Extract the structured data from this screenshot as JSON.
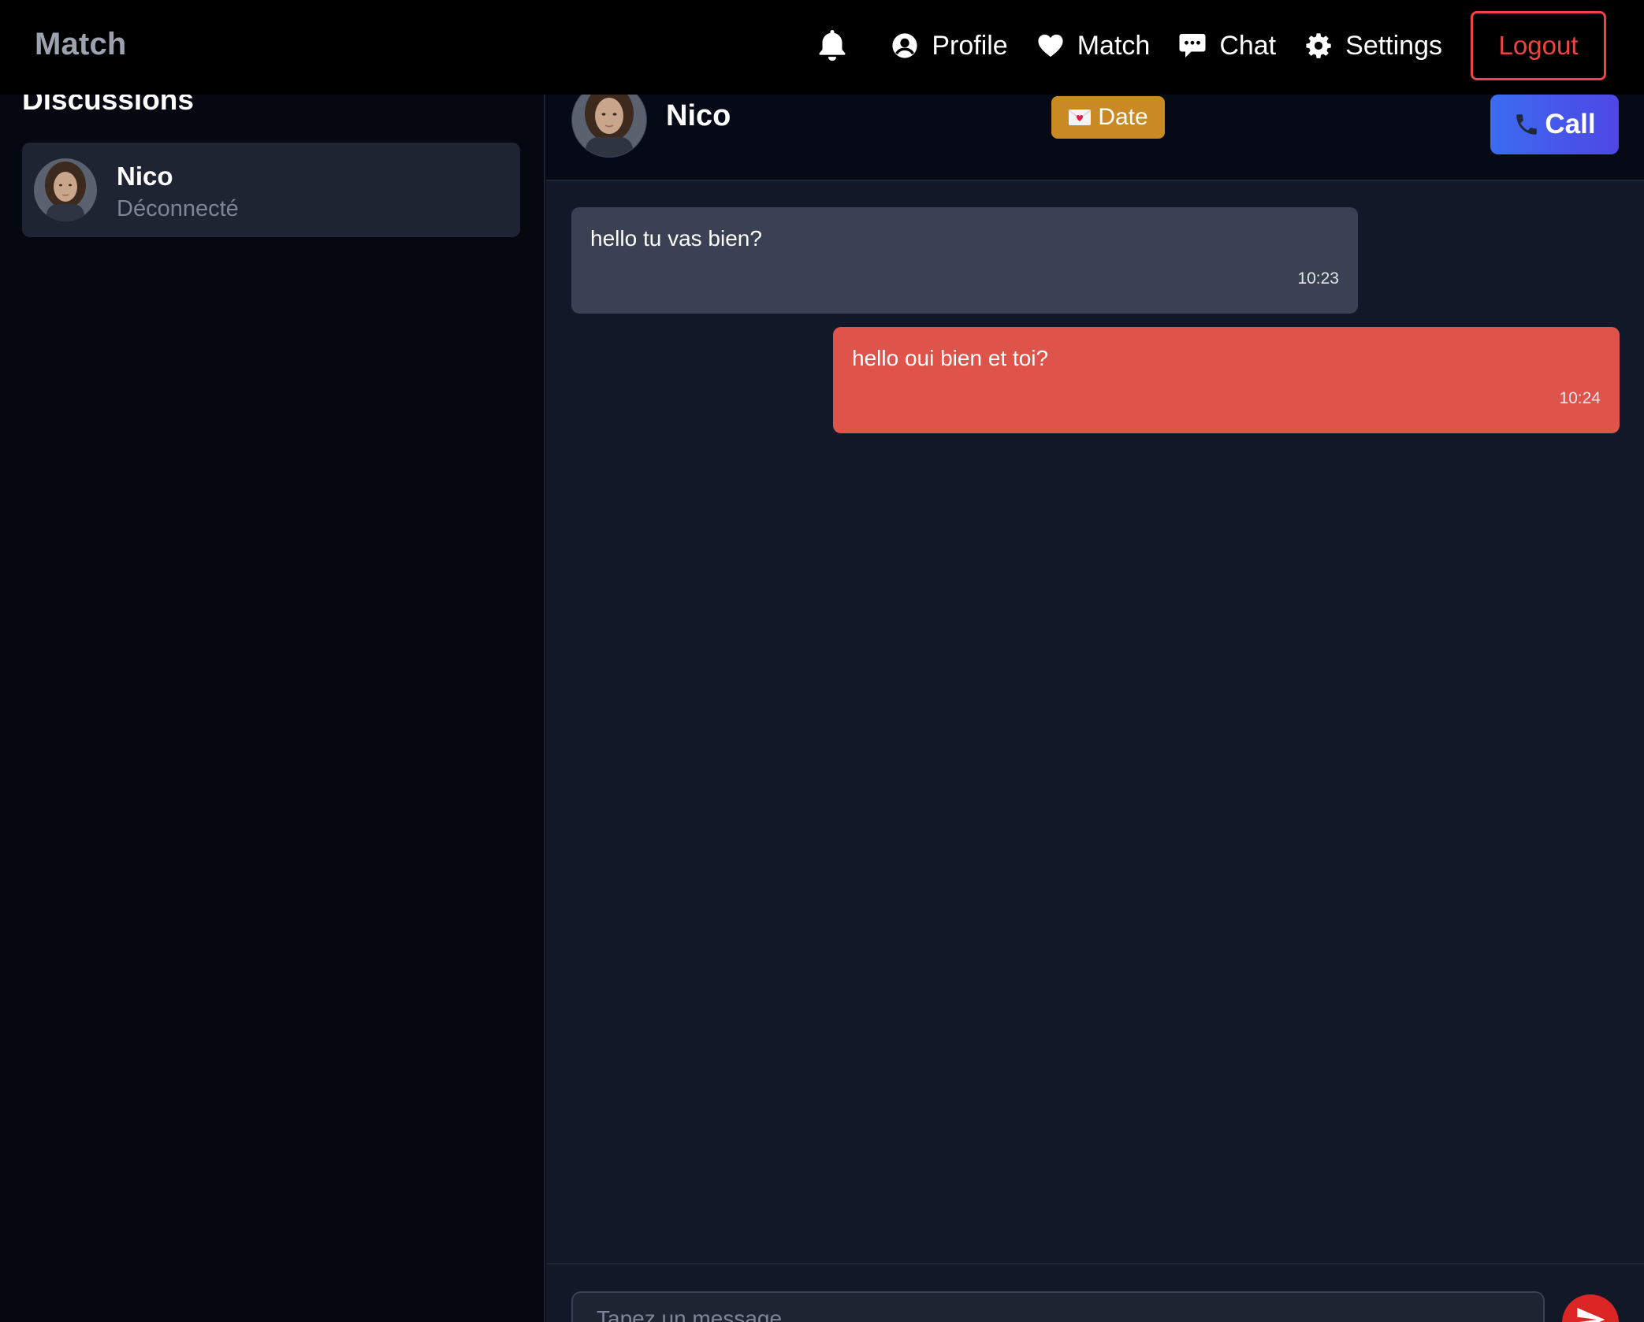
{
  "app": {
    "brand": "Match"
  },
  "nav": {
    "items": [
      {
        "label": "Profile",
        "icon": "user-circle-icon"
      },
      {
        "label": "Match",
        "icon": "heart-icon"
      },
      {
        "label": "Chat",
        "icon": "chat-bubble-icon"
      },
      {
        "label": "Settings",
        "icon": "gear-icon"
      }
    ],
    "logout_label": "Logout",
    "notification_icon": "bell-icon"
  },
  "sidebar": {
    "title": "Discussions",
    "conversations": [
      {
        "name": "Nico",
        "status": "Déconnecté"
      }
    ]
  },
  "chat": {
    "header": {
      "name": "Nico",
      "date_label": "Date",
      "call_label": "Call"
    },
    "messages": [
      {
        "direction": "incoming",
        "text": "hello tu vas bien?",
        "time": "10:23"
      },
      {
        "direction": "outgoing",
        "text": "hello oui bien et toi?",
        "time": "10:24"
      }
    ],
    "input": {
      "placeholder": "Tapez un message..."
    }
  },
  "colors": {
    "accent_red": "#ef4444",
    "outgoing_bubble": "#df544a",
    "incoming_bubble": "#3a4152",
    "date_badge": "#c98a23",
    "call_blue": "#3b6cf0"
  }
}
